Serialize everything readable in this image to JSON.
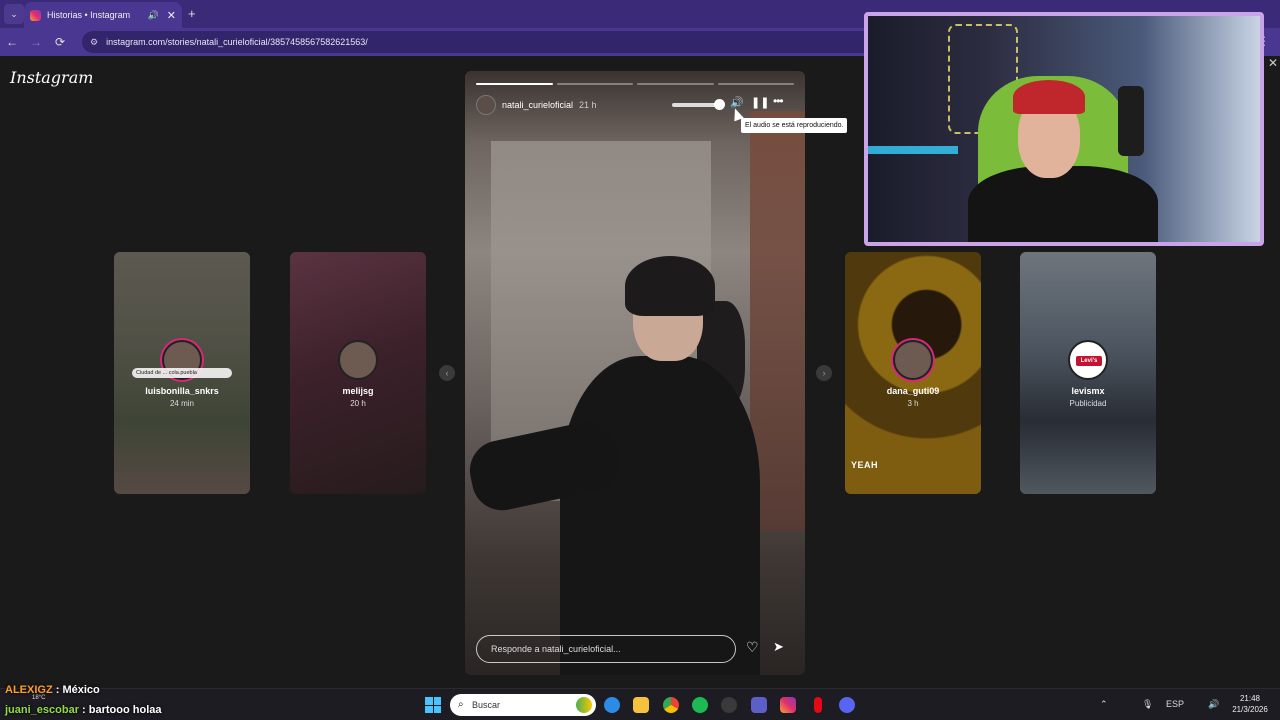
{
  "browser": {
    "tab_title": "Historias • Instagram",
    "tab_close": "✕",
    "new_tab": "+",
    "back": "←",
    "forward": "→",
    "reload": "⟳",
    "url": "instagram.com/stories/natali_curieloficial/3857458567582621563/",
    "menu": "⋮"
  },
  "page": {
    "logo": "Instagram",
    "close": "✕"
  },
  "stories": [
    {
      "user": "luisbonilla_snkrs",
      "sub": "24 min",
      "location": "Ciudad de ... cola.puebla"
    },
    {
      "user": "melijsg",
      "sub": "20 h"
    },
    {
      "user": "dana_guti09",
      "sub": "3 h",
      "sticker": "YEAH"
    },
    {
      "user": "levismx",
      "sub": "Publicidad",
      "brand": "Levi's"
    }
  ],
  "main_story": {
    "user": "natali_curieloficial",
    "time": "21 h",
    "progress": {
      "segments": 4,
      "completed": 1
    },
    "volume_level": 0.95,
    "tooltip": "El audio se está reproduciendo.",
    "reply_placeholder": "Responde a natali_curieloficial...",
    "prev_arrow": "‹",
    "next_arrow": "›"
  },
  "chat": [
    {
      "user": "ALEXIGZ",
      "message": " : México"
    },
    {
      "user": "juani_escobar",
      "message": " : bartooo holaa"
    }
  ],
  "taskbar": {
    "weather": "18°C",
    "search_label": "Buscar",
    "lang": "ESP",
    "time": "21:48",
    "date": "21/3/2026"
  },
  "colors": {
    "tabbar": "#3b2a78",
    "addrbar": "#4a3791",
    "page_bg": "#1a1a1a",
    "webcam_border": "#c9a4e9",
    "chat_user1": "#ff9c2b",
    "chat_user2": "#93d94a"
  }
}
